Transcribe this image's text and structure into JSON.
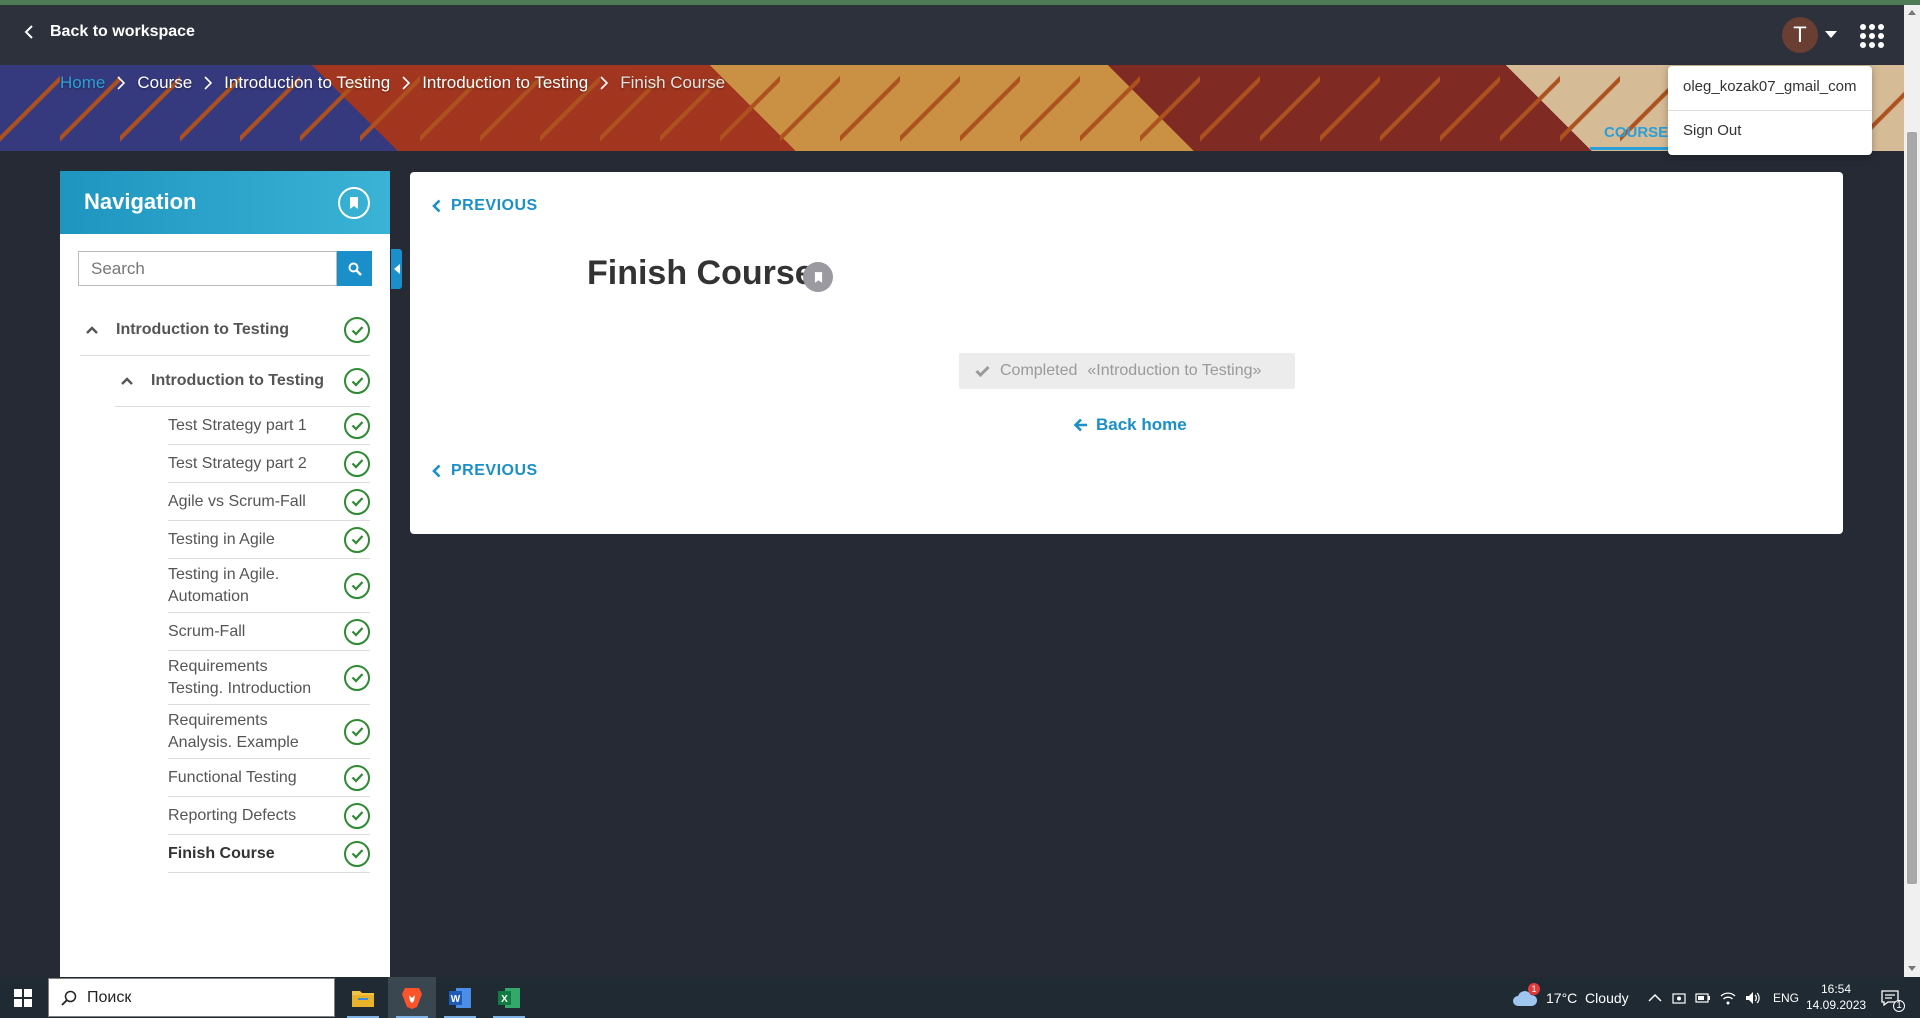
{
  "topbar": {
    "back_label": "Back to workspace",
    "avatar_letter": "T"
  },
  "breadcrumb": [
    {
      "label": "Home",
      "type": "home"
    },
    {
      "label": "Course",
      "type": "link"
    },
    {
      "label": "Introduction to Testing",
      "type": "link"
    },
    {
      "label": "Introduction to Testing",
      "type": "link"
    },
    {
      "label": "Finish Course",
      "type": "current"
    }
  ],
  "banner": {
    "tab_label": "COURSEW"
  },
  "user_menu": {
    "username": "oleg_kozak07_gmail_com",
    "sign_out": "Sign Out"
  },
  "navigation": {
    "title": "Navigation",
    "search_placeholder": "Search",
    "items": [
      {
        "label": "Introduction to Testing",
        "level": 0,
        "expanded": true,
        "completed": true
      },
      {
        "label": "Introduction to Testing",
        "level": 1,
        "expanded": true,
        "completed": true
      },
      {
        "label": "Test Strategy part 1",
        "level": 2,
        "completed": true
      },
      {
        "label": "Test Strategy part 2",
        "level": 2,
        "completed": true
      },
      {
        "label": "Agile vs Scrum-Fall",
        "level": 2,
        "completed": true
      },
      {
        "label": "Testing in Agile",
        "level": 2,
        "completed": true
      },
      {
        "label": "Testing in Agile. Automation",
        "level": 2,
        "completed": true
      },
      {
        "label": "Scrum-Fall",
        "level": 2,
        "completed": true
      },
      {
        "label": "Requirements Testing. Introduction",
        "level": 2,
        "completed": true
      },
      {
        "label": "Requirements Analysis. Example",
        "level": 2,
        "completed": true
      },
      {
        "label": "Functional Testing",
        "level": 2,
        "completed": true
      },
      {
        "label": "Reporting Defects",
        "level": 2,
        "completed": true
      },
      {
        "label": "Finish Course",
        "level": 2,
        "completed": true,
        "active": true
      }
    ]
  },
  "content": {
    "previous_label": "PREVIOUS",
    "title": "Finish Course",
    "completed_label": "Completed",
    "completed_course": "«Introduction to Testing»",
    "back_home": "Back home"
  },
  "taskbar": {
    "search_placeholder": "Поиск",
    "weather": "17°C  Cloudy",
    "weather_badge": "1",
    "language": "ENG",
    "time": "16:54",
    "date": "14.09.2023",
    "notification_count": "1"
  },
  "colors": {
    "accent": "#1a8fc9",
    "check_green": "#2f8a33",
    "page_bg": "#252a34",
    "topbar_bg": "#2d313b"
  }
}
